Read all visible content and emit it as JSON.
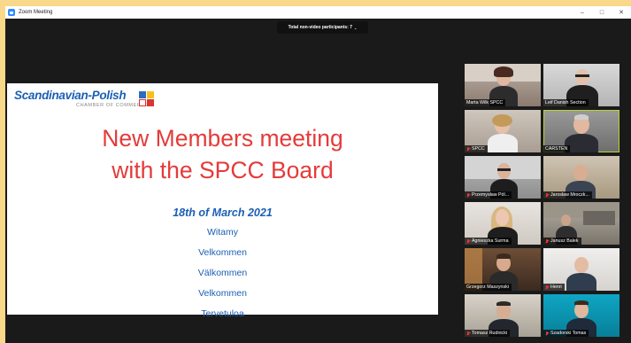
{
  "window": {
    "title": "Zoom Meeting"
  },
  "participants_pill": {
    "label": "Total non-video participants: 7",
    "chevron": "⌄"
  },
  "slide": {
    "logo_name": "Scandinavian-Polish",
    "logo_sub": "CHAMBER OF COMMERCE",
    "title_line1": "New Members meeting",
    "title_line2": "with the SPCC Board",
    "date": "18th of March 2021",
    "greetings": [
      "Witamy",
      "Velkommen",
      "Välkommen",
      "Velkommen",
      "Tervetuloa"
    ]
  },
  "gallery": {
    "tiles": [
      {
        "name": "Marta Wilk SPCC",
        "muted": false
      },
      {
        "name": "Leif Danish Section",
        "muted": false
      },
      {
        "name": "SPCC",
        "muted": true
      },
      {
        "name": "CARSTEN",
        "muted": false
      },
      {
        "name": "Przemysław Pól...",
        "muted": true
      },
      {
        "name": "Jarosław Mroczk...",
        "muted": true
      },
      {
        "name": "Agnieszka Surma",
        "muted": true
      },
      {
        "name": "Janusz Balek",
        "muted": true
      },
      {
        "name": "Grzegorz Maszynski",
        "muted": false
      },
      {
        "name": "Henri",
        "muted": true
      },
      {
        "name": "Tomasz Rudnicki",
        "muted": true
      },
      {
        "name": "Szadorski Tomas",
        "muted": true
      }
    ]
  },
  "colors": {
    "accent_green": "#b9d335",
    "slide_title_red": "#e43b3a",
    "brand_blue": "#1a5fb4",
    "frame_yellow": "#f9d889"
  }
}
